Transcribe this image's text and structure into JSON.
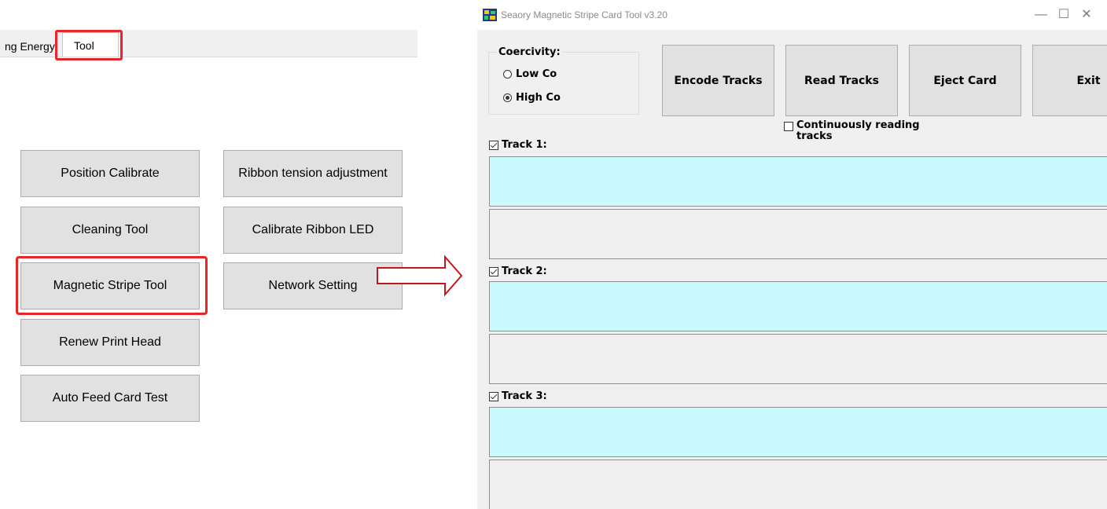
{
  "left_panel": {
    "tabs": {
      "previous_partial": "ng Energy",
      "active": "Tool"
    },
    "buttons": {
      "position_calibrate": "Position Calibrate",
      "ribbon_tension": "Ribbon tension adjustment",
      "cleaning_tool": "Cleaning Tool",
      "calibrate_ribbon_led": "Calibrate Ribbon LED",
      "magnetic_stripe_tool": "Magnetic Stripe Tool",
      "network_setting": "Network Setting",
      "renew_print_head": "Renew Print Head",
      "auto_feed_card_test": "Auto Feed Card Test"
    },
    "highlight_color": "#e8262a",
    "arrow_color": "#c0161c"
  },
  "window": {
    "title": "Seaory Magnetic Stripe Card Tool   v3.20",
    "controls": {
      "minimize": "—",
      "maximize": "☐",
      "close": "✕"
    },
    "coercivity": {
      "label": "Coercivity:",
      "options": [
        {
          "label": "Low Co",
          "selected": false
        },
        {
          "label": "High Co",
          "selected": true
        }
      ]
    },
    "actions": {
      "encode": "Encode Tracks",
      "read": "Read Tracks",
      "eject": "Eject Card",
      "exit": "Exit"
    },
    "continuous": {
      "label": "Continuously reading tracks",
      "checked": false
    },
    "tracks": [
      {
        "label": "Track 1:",
        "checked": true,
        "data": "",
        "result": ""
      },
      {
        "label": "Track 2:",
        "checked": true,
        "data": "",
        "result": ""
      },
      {
        "label": "Track 3:",
        "checked": true,
        "data": "",
        "result": ""
      }
    ],
    "colors": {
      "track_data_bg": "#c8fafe",
      "window_bg": "#f0f0f0",
      "button_bg": "#e1e1e1"
    }
  }
}
